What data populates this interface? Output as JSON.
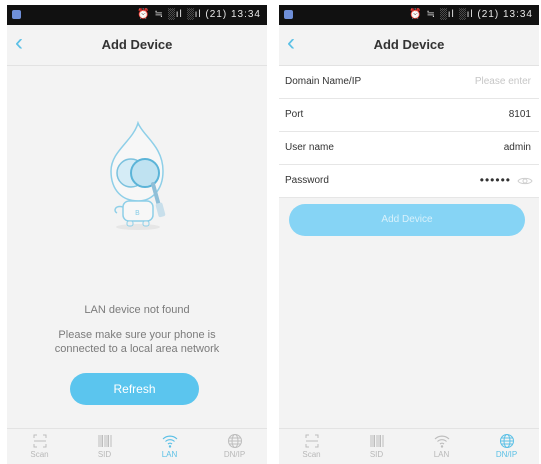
{
  "status_bar": {
    "icons_text": "⏰ ≒ ░ıl ░ıl (21) 13:34",
    "time": "13:34"
  },
  "left": {
    "title": "Add Device",
    "message_title": "LAN device not found",
    "message_line1": "Please make sure your phone is",
    "message_line2": "connected to a local area network",
    "refresh_label": "Refresh",
    "active_tab": "LAN"
  },
  "right": {
    "title": "Add Device",
    "fields": [
      {
        "label": "Domain Name/IP",
        "value": "",
        "placeholder": "Please enter"
      },
      {
        "label": "Port",
        "value": "8101"
      },
      {
        "label": "User name",
        "value": "admin"
      },
      {
        "label": "Password",
        "value": "••••••"
      }
    ],
    "add_device_label": "Add Device",
    "active_tab": "DN/IP"
  },
  "tabs": [
    {
      "label": "Scan",
      "icon": "scan-icon"
    },
    {
      "label": "SID",
      "icon": "barcode-icon"
    },
    {
      "label": "LAN",
      "icon": "wifi-icon"
    },
    {
      "label": "DN/IP",
      "icon": "globe-icon"
    }
  ],
  "colors": {
    "accent": "#5bc0e6",
    "button": "#5bc5ee",
    "button_disabled": "#86d4f5",
    "background": "#f3f3f3"
  }
}
